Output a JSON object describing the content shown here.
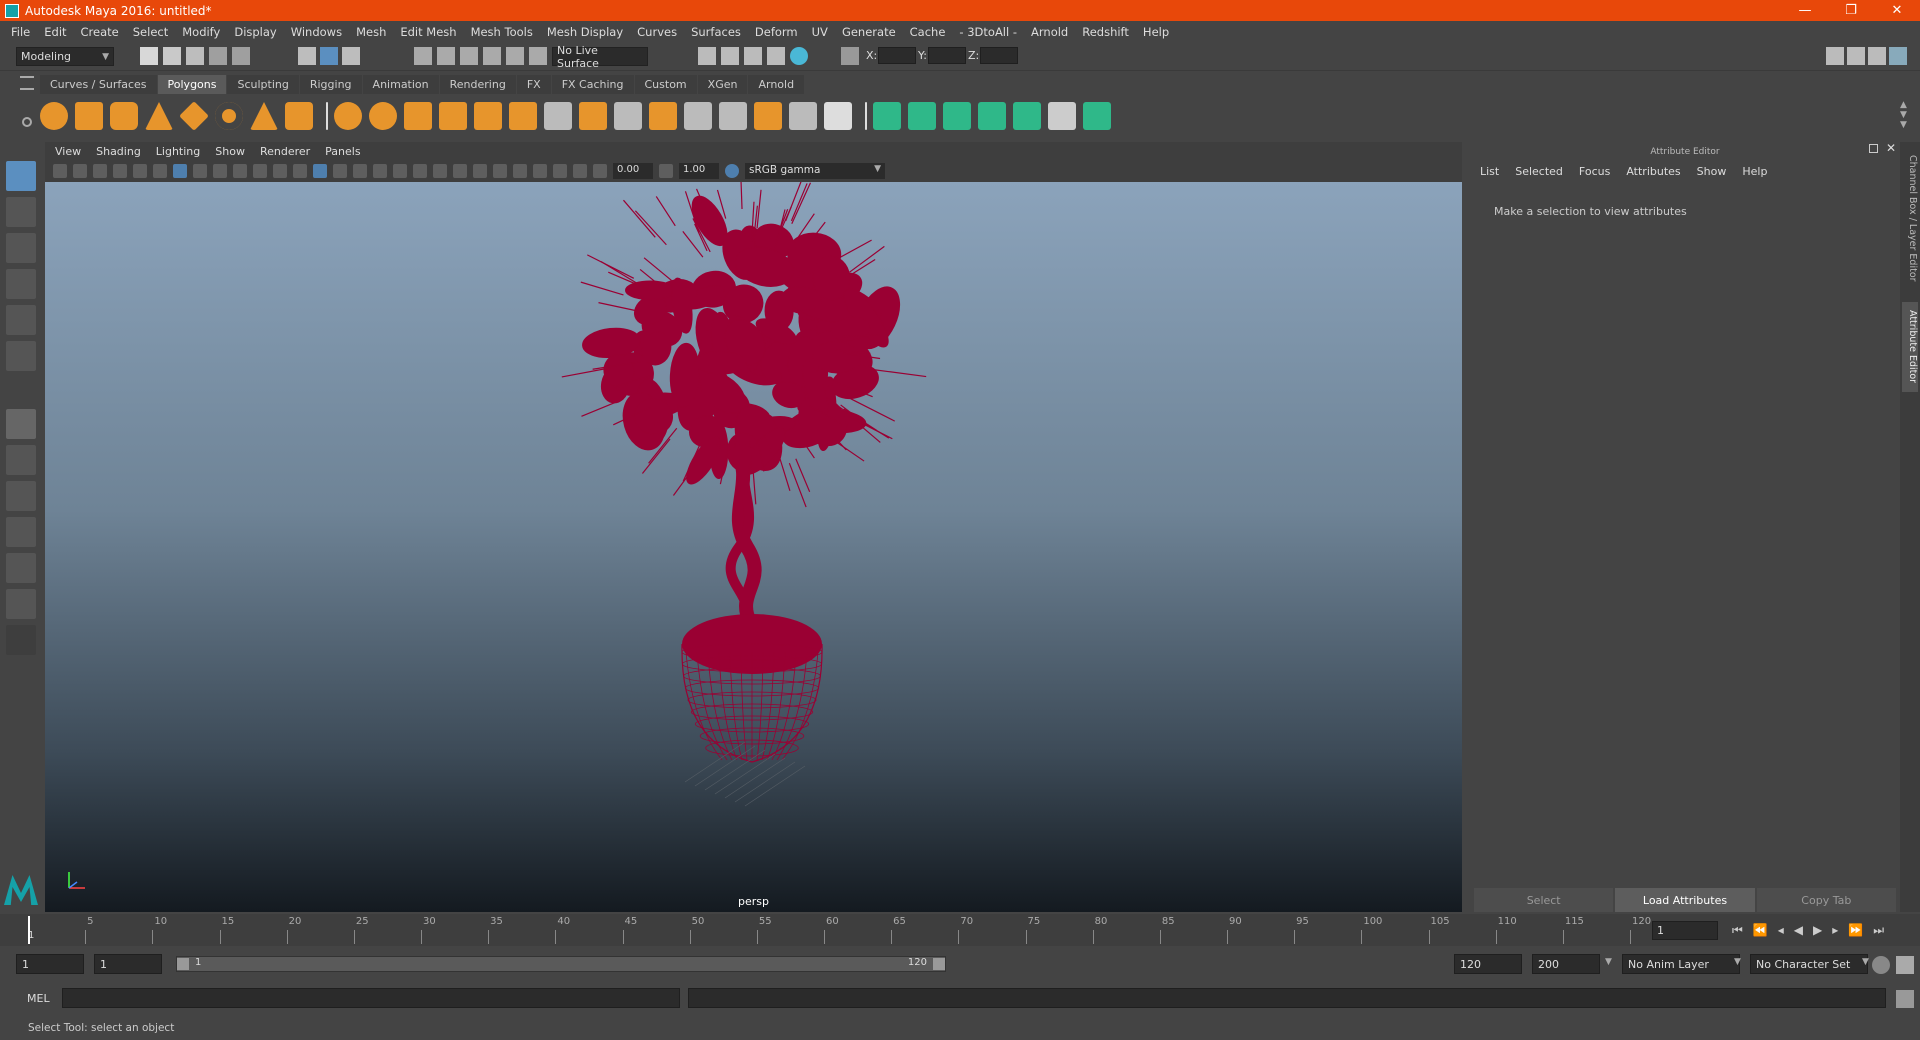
{
  "window": {
    "title": "Autodesk Maya 2016: untitled*",
    "min": "—",
    "max": "❐",
    "close": "✕"
  },
  "menubar": [
    "File",
    "Edit",
    "Create",
    "Select",
    "Modify",
    "Display",
    "Windows",
    "Mesh",
    "Edit Mesh",
    "Mesh Tools",
    "Mesh Display",
    "Curves",
    "Surfaces",
    "Deform",
    "UV",
    "Generate",
    "Cache",
    "- 3DtoAll -",
    "Arnold",
    "Redshift",
    "Help"
  ],
  "status": {
    "mode": "Modeling",
    "live_surface": "No Live Surface",
    "x_label": "X:",
    "y_label": "Y:",
    "z_label": "Z:"
  },
  "shelf": {
    "tabs": [
      "Curves / Surfaces",
      "Polygons",
      "Sculpting",
      "Rigging",
      "Animation",
      "Rendering",
      "FX",
      "FX Caching",
      "Custom",
      "XGen",
      "Arnold"
    ],
    "active": "Polygons"
  },
  "viewport": {
    "menu": [
      "View",
      "Shading",
      "Lighting",
      "Show",
      "Renderer",
      "Panels"
    ],
    "exposure": "0.00",
    "gamma": "1.00",
    "color_space": "sRGB gamma",
    "camera_label": "persp",
    "wire_color": "#9a0033"
  },
  "attribute_editor": {
    "title": "Attribute Editor",
    "menu": [
      "List",
      "Selected",
      "Focus",
      "Attributes",
      "Show",
      "Help"
    ],
    "message": "Make a selection to view attributes",
    "buttons": {
      "select": "Select",
      "load": "Load Attributes",
      "copy": "Copy Tab"
    }
  },
  "side_tabs": {
    "channel": "Channel Box / Layer Editor",
    "attr": "Attribute Editor"
  },
  "timeline": {
    "ticks": [
      "5",
      "10",
      "15",
      "20",
      "25",
      "30",
      "35",
      "40",
      "45",
      "50",
      "55",
      "60",
      "65",
      "70",
      "75",
      "80",
      "85",
      "90",
      "95",
      "100",
      "105",
      "110",
      "115",
      "120"
    ],
    "start_frame": "1",
    "current_frame": "1"
  },
  "range": {
    "start": "1",
    "inner_start": "1",
    "slider_start": "1",
    "slider_end": "120",
    "end": "120",
    "max": "200",
    "anim_layer": "No Anim Layer",
    "char_set": "No Character Set"
  },
  "cmd": {
    "label": "MEL"
  },
  "help_line": "Select Tool: select an object"
}
